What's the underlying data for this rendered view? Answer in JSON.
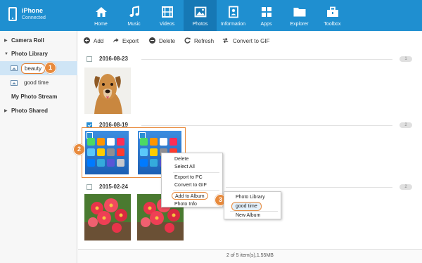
{
  "device": {
    "name": "iPhone",
    "status": "Connected"
  },
  "nav": [
    {
      "label": "Home",
      "icon": "home-icon"
    },
    {
      "label": "Music",
      "icon": "music-icon"
    },
    {
      "label": "Videos",
      "icon": "film-icon"
    },
    {
      "label": "Photos",
      "icon": "photo-icon",
      "active": true
    },
    {
      "label": "Information",
      "icon": "contacts-icon"
    },
    {
      "label": "Apps",
      "icon": "apps-icon"
    },
    {
      "label": "Explorer",
      "icon": "folder-icon"
    },
    {
      "label": "Toolbox",
      "icon": "toolbox-icon"
    }
  ],
  "sidebar": {
    "camera_roll": "Camera Roll",
    "photo_library": "Photo Library",
    "albums": [
      "beauty",
      "good time"
    ],
    "my_photo_stream": "My Photo Stream",
    "photo_shared": "Photo Shared"
  },
  "toolbar": {
    "add": "Add",
    "export": "Export",
    "delete": "Delete",
    "refresh": "Refresh",
    "convert": "Convert to GIF"
  },
  "groups": [
    {
      "date": "2016-08-23",
      "count": "1"
    },
    {
      "date": "2016-08-19",
      "count": "2"
    },
    {
      "date": "2015-02-24",
      "count": "2"
    }
  ],
  "context_menu": {
    "delete": "Delete",
    "select_all": "Select All",
    "export_pc": "Export to PC",
    "convert_gif": "Convert to GIF",
    "add_to_album": "Add to Album",
    "photo_info": "Photo Info"
  },
  "submenu": {
    "photo_library": "Photo Library",
    "good_time": "good time",
    "new_album": "New Album"
  },
  "callouts": [
    "1",
    "2",
    "3"
  ],
  "footer": {
    "status": "2 of 5 item(s),1.55MB"
  },
  "colors": {
    "topbar": "#1f8fd0",
    "active_tab": "#1678b5",
    "callout": "#e88a3c",
    "selected": "#cfe5f6"
  }
}
